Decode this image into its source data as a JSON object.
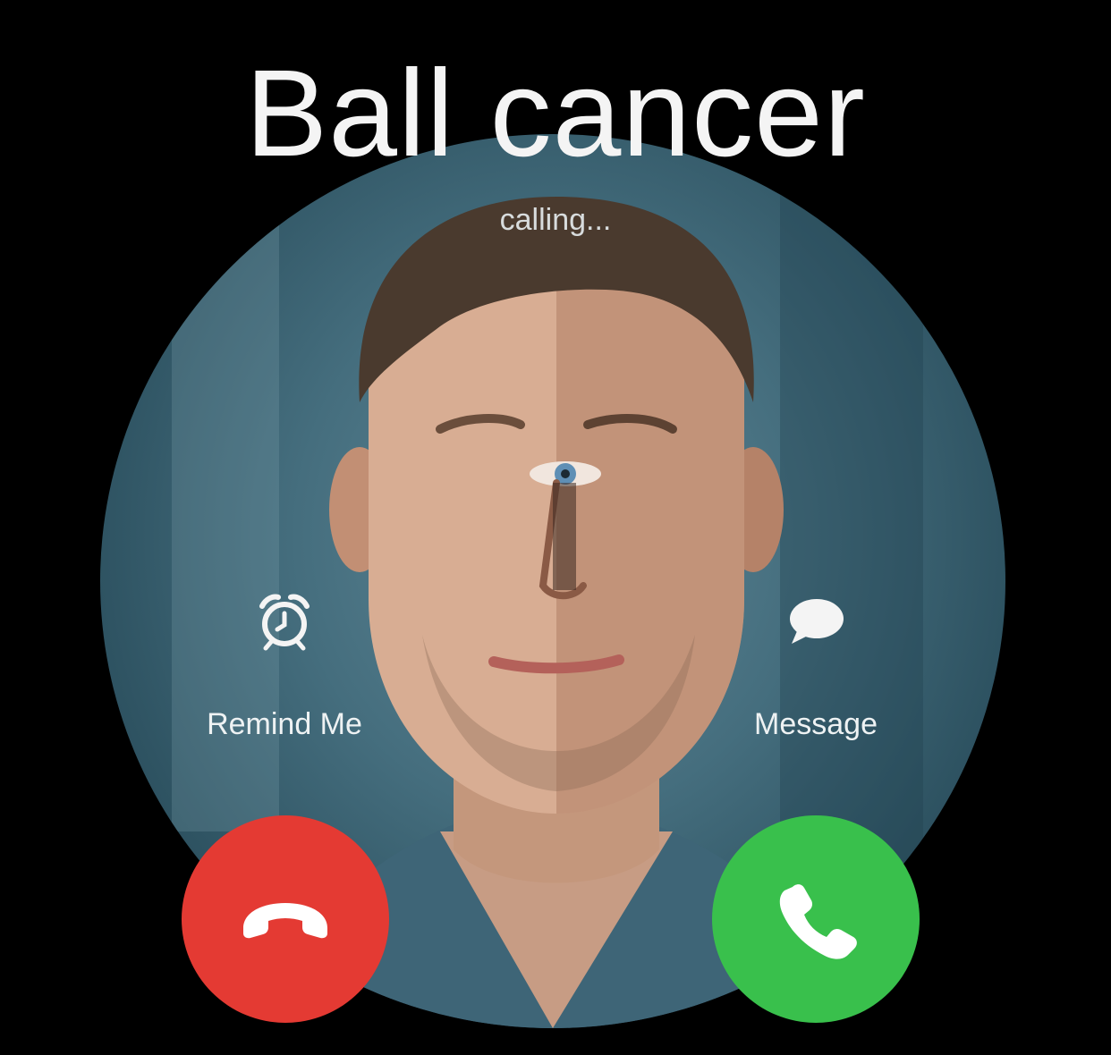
{
  "call": {
    "caller_name": "Ball cancer",
    "status": "calling..."
  },
  "options": {
    "remind_label": "Remind Me",
    "message_label": "Message"
  },
  "actions": {
    "decline_icon": "phone-hangup-icon",
    "accept_icon": "phone-answer-icon"
  },
  "colors": {
    "background": "#000000",
    "decline": "#e43a33",
    "accept": "#39c04c",
    "text": "#f4f4f4"
  }
}
